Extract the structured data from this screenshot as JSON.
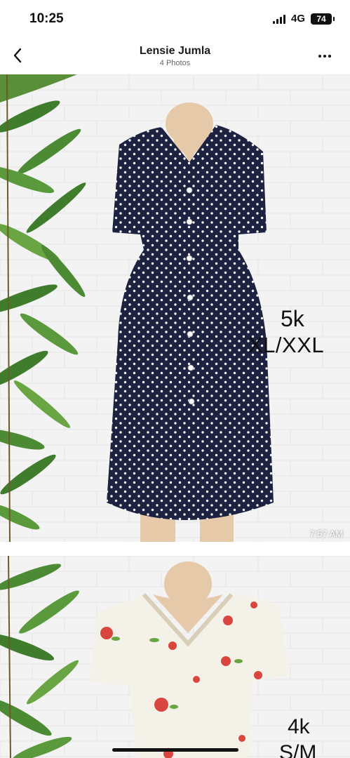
{
  "status_bar": {
    "time": "10:25",
    "network": "4G",
    "battery": "74"
  },
  "header": {
    "title": "Lensie Jumla",
    "subtitle": "4 Photos",
    "back_icon": "chevron-left-icon",
    "more_icon": "more-horizontal-icon"
  },
  "photos": [
    {
      "price": "5k",
      "size": "XL/XXL",
      "timestamp": "7:57 AM",
      "dress_color": "#1c2240",
      "dot_color": "#f4f4f4"
    },
    {
      "price": "4k",
      "size": "S/M",
      "dress_color": "#f4f1e8",
      "flower_color": "#d9453f"
    }
  ]
}
